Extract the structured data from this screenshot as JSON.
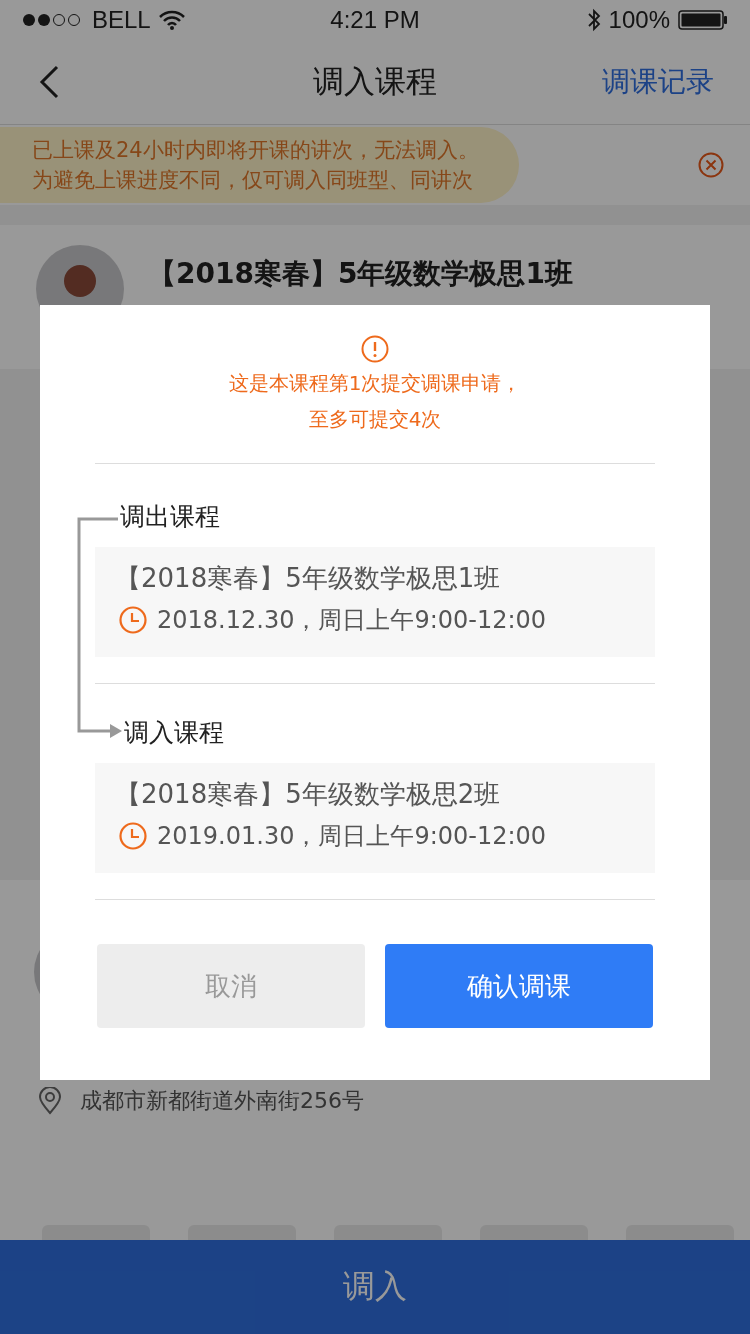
{
  "status_bar": {
    "carrier": "BELL",
    "time": "4:21 PM",
    "battery": "100%"
  },
  "nav": {
    "title": "调入课程",
    "action": "调课记录"
  },
  "notice": {
    "lines": [
      "已上课及24小时内即将开课的讲次，无法调入。",
      "为避免上课进度不同，仅可调入同班型、同讲次"
    ]
  },
  "course": {
    "title": "【2018寒春】5年级数学极思1班"
  },
  "address": "成都市新都街道外南街256号",
  "bottom_button": "调入",
  "dialog": {
    "message_lines": [
      "这是本课程第1次提交调课申请，",
      "至多可提交4次"
    ],
    "sections": [
      {
        "kind": "out",
        "label": "调出课程",
        "course": "【2018寒春】5年级数学极思1班",
        "time": "2018.12.30，周日上午9:00-12:00"
      },
      {
        "kind": "in",
        "label": "调入课程",
        "course": "【2018寒春】5年级数学极思2班",
        "time": "2019.01.30，周日上午9:00-12:00"
      }
    ],
    "buttons": [
      {
        "kind": "cancel",
        "label": "取消"
      },
      {
        "kind": "confirm",
        "label": "确认调课"
      }
    ]
  }
}
